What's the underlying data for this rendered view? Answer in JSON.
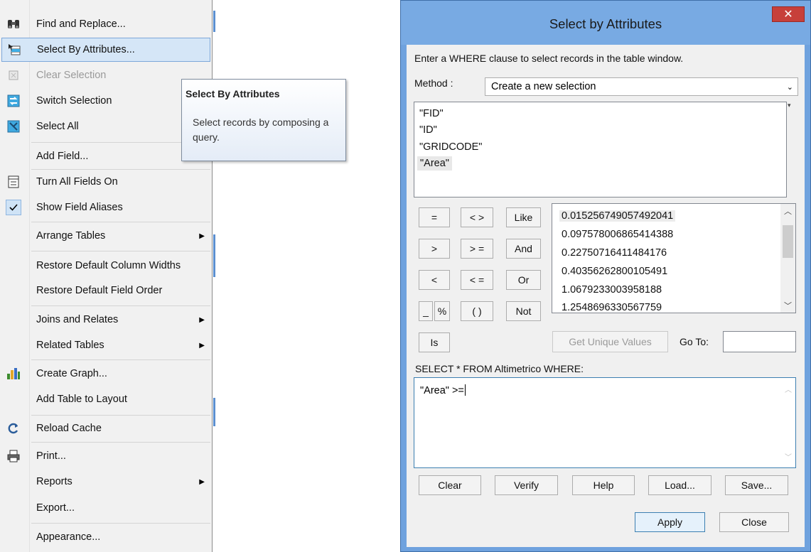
{
  "menu": {
    "items": [
      {
        "label": "Find and Replace...",
        "icon": "binoculars-icon",
        "submenu": false
      },
      {
        "label": "Select By Attributes...",
        "icon": "select-by-attributes-icon",
        "submenu": false,
        "highlighted": true
      },
      {
        "label": "Clear Selection",
        "icon": "clear-selection-icon",
        "submenu": false,
        "disabled": true
      },
      {
        "label": "Switch Selection",
        "icon": "switch-selection-icon",
        "submenu": false
      },
      {
        "label": "Select All",
        "icon": "select-all-icon",
        "submenu": false
      },
      {
        "label": "Add Field...",
        "icon": "",
        "submenu": false
      },
      {
        "label": "Turn All Fields On",
        "icon": "table-fields-icon",
        "submenu": false
      },
      {
        "label": "Show Field Aliases",
        "icon": "checkmark-icon",
        "submenu": false,
        "checked": true
      },
      {
        "label": "Arrange Tables",
        "icon": "",
        "submenu": true
      },
      {
        "label": "Restore Default Column Widths",
        "icon": "",
        "submenu": false
      },
      {
        "label": "Restore Default Field Order",
        "icon": "",
        "submenu": false
      },
      {
        "label": "Joins and Relates",
        "icon": "",
        "submenu": true
      },
      {
        "label": "Related Tables",
        "icon": "",
        "submenu": true
      },
      {
        "label": "Create Graph...",
        "icon": "bar-chart-icon",
        "submenu": false
      },
      {
        "label": "Add Table to Layout",
        "icon": "",
        "submenu": false
      },
      {
        "label": "Reload Cache",
        "icon": "reload-icon",
        "submenu": false
      },
      {
        "label": "Print...",
        "icon": "printer-icon",
        "submenu": false
      },
      {
        "label": "Reports",
        "icon": "",
        "submenu": true
      },
      {
        "label": "Export...",
        "icon": "",
        "submenu": false
      },
      {
        "label": "Appearance...",
        "icon": "",
        "submenu": false
      }
    ],
    "submenu_arrow": "▶"
  },
  "tooltip": {
    "title": "Select By Attributes",
    "body": "Select records by composing a query."
  },
  "dialog": {
    "title": "Select by Attributes",
    "close_glyph": "✕",
    "instruction": "Enter a WHERE clause to select records in the table window.",
    "method_label": "Method :",
    "method_value": "Create a new selection",
    "fields": [
      "\"FID\"",
      "\"ID\"",
      "\"GRIDCODE\"",
      "\"Area\""
    ],
    "selected_field": "\"Area\"",
    "operators": {
      "eq": "=",
      "neq": "< >",
      "like": "Like",
      "gt": ">",
      "gte": "> =",
      "and": "And",
      "lt": "<",
      "lte": "< =",
      "or": "Or",
      "underscore": "_",
      "percent": "%",
      "parens": "( )",
      "not": "Not",
      "is": "Is"
    },
    "unique_values": [
      "0.015256749057492041",
      "0.097578006865414388",
      "0.22750716411484176",
      "0.40356262800105491",
      "1.0679233003958188",
      "1.2548696330567759"
    ],
    "get_unique_label": "Get Unique Values",
    "goto_label": "Go To:",
    "goto_value": "",
    "sql_prefix": "SELECT * FROM Altimetrico WHERE:",
    "sql_expression": "\"Area\" >=",
    "buttons": {
      "clear": "Clear",
      "verify": "Verify",
      "help": "Help",
      "load": "Load...",
      "save": "Save...",
      "apply": "Apply",
      "close": "Close"
    }
  },
  "colors": {
    "titlebar": "#78aae3",
    "close_button": "#c7403a",
    "menu_highlight": "#d5e6f7",
    "accent_blue": "#3c7fb1"
  }
}
